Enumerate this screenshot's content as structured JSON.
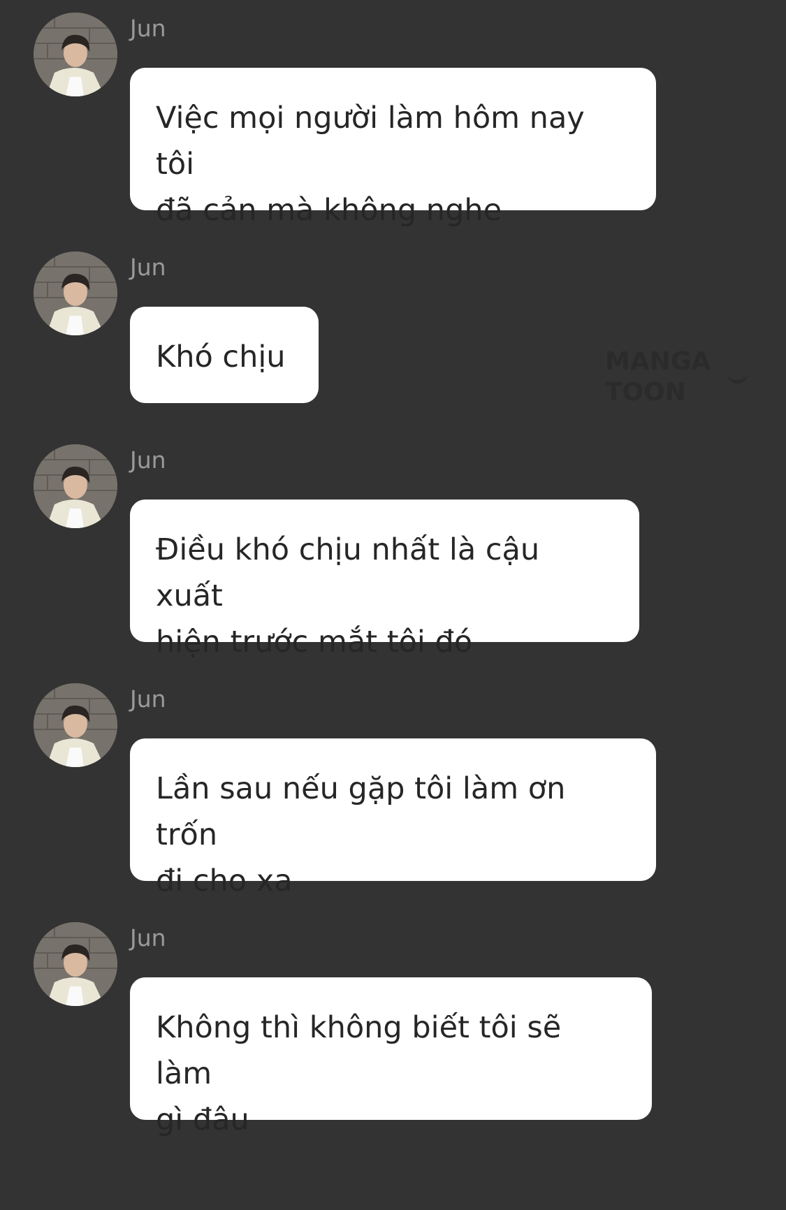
{
  "messages": [
    {
      "sender": "Jun",
      "text": "Việc mọi người làm hôm nay tôi\nđã cản mà không nghe"
    },
    {
      "sender": "Jun",
      "text": "Khó chịu"
    },
    {
      "sender": "Jun",
      "text": "Điều khó chịu nhất là cậu xuất\nhiện trước mắt tôi đó"
    },
    {
      "sender": "Jun",
      "text": "Lần sau nếu gặp tôi làm ơn trốn\nđi cho xa"
    },
    {
      "sender": "Jun",
      "text": "Không thì không biết tôi sẽ làm\ngì đâu"
    }
  ],
  "watermark": {
    "text": "MANGA TOON"
  },
  "colors": {
    "background": "#333333",
    "bubble": "#ffffff",
    "message_text": "#262626",
    "sender_name": "#9a9a9a",
    "watermark": "#2b2b2b"
  },
  "icons": {
    "avatar": "profile-photo-avatar"
  }
}
